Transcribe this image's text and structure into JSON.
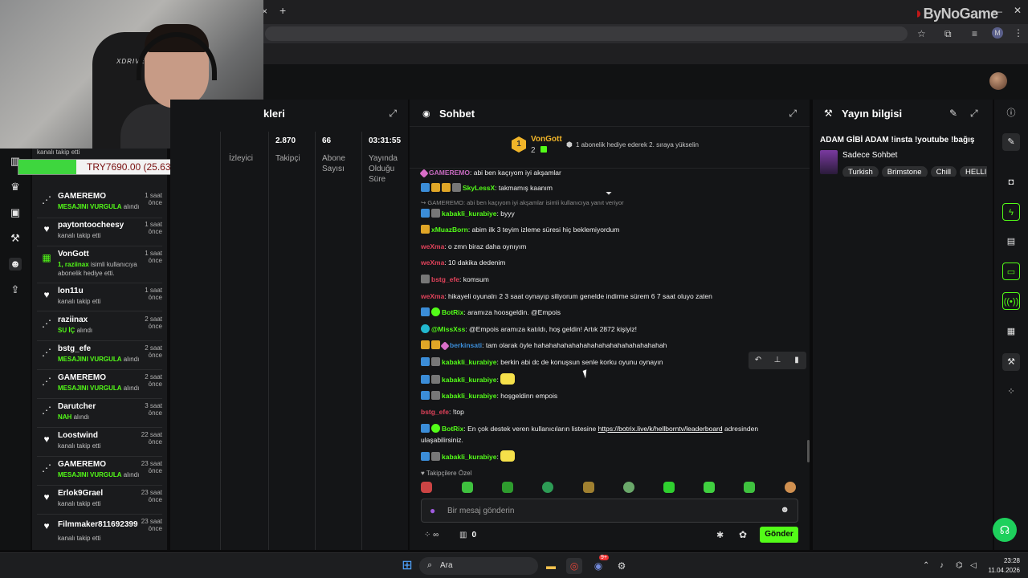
{
  "browser": {
    "close_tab": "×",
    "new_tab": "+",
    "watermark": "ByNoGame",
    "profile_initial": "M"
  },
  "webcam": {
    "chair_brand": "XDRIVE"
  },
  "donation": {
    "text": "TRY7690.00 (25.63%)",
    "progress_percent": 25.63,
    "fill_color": "#3ed63e"
  },
  "mini_sidebar": {
    "icons": [
      "chart-icon",
      "trophy-icon",
      "video-icon",
      "wrench-icon",
      "users-icon",
      "upload-icon"
    ]
  },
  "feed": {
    "top_line": "kanalı takip etti",
    "items": [
      {
        "icon": "share-icon",
        "user": "GAMEREMO",
        "time": "1 saat önce",
        "highlight": "MESAJINI VURGULA",
        "desc": "alındı"
      },
      {
        "icon": "heart-icon",
        "user": "paytontoocheesy",
        "time": "1 saat önce",
        "highlight": "",
        "desc": "kanalı takip etti"
      },
      {
        "icon": "gift-icon",
        "user": "VonGott",
        "time": "1 saat önce",
        "highlight": "1, raziinax",
        "desc": "isimli kullanıcıya",
        "desc2": "abonelik hediye etti."
      },
      {
        "icon": "heart-icon",
        "user": "lon11u",
        "time": "1 saat önce",
        "highlight": "",
        "desc": "kanalı takip etti"
      },
      {
        "icon": "share-icon",
        "user": "raziinax",
        "time": "2 saat önce",
        "highlight": "SU İÇ",
        "desc": "alındı"
      },
      {
        "icon": "share-icon",
        "user": "bstg_efe",
        "time": "2 saat önce",
        "highlight": "MESAJINI VURGULA",
        "desc": "alındı"
      },
      {
        "icon": "share-icon",
        "user": "GAMEREMO",
        "time": "2 saat önce",
        "highlight": "MESAJINI VURGULA",
        "desc": "alındı"
      },
      {
        "icon": "share-icon",
        "user": "Darutcher",
        "time": "3 saat önce",
        "highlight": "NAH",
        "desc": "alındı"
      },
      {
        "icon": "heart-icon",
        "user": "Loostwind",
        "time": "22 saat önce",
        "highlight": "",
        "desc": "kanalı takip etti"
      },
      {
        "icon": "share-icon",
        "user": "GAMEREMO",
        "time": "23 saat önce",
        "highlight": "MESAJINI VURGULA",
        "desc": "alındı"
      },
      {
        "icon": "heart-icon",
        "user": "Erlok9Grael",
        "time": "23 saat önce",
        "highlight": "",
        "desc": "kanalı takip etti"
      },
      {
        "icon": "heart-icon",
        "user": "Filmmaker811692399",
        "time": "23 saat önce",
        "highlight": "",
        "desc": "kanalı takip etti"
      }
    ]
  },
  "stats": {
    "title": "kleri",
    "hidden_label": "İzleyici",
    "columns": [
      {
        "value": "2.870",
        "label": "Takipçi"
      },
      {
        "value": "66",
        "label": "Abone Sayısı"
      },
      {
        "value": "03:31:55",
        "label": "Yayında Olduğu Süre"
      }
    ]
  },
  "chat": {
    "title": "Sohbet",
    "pinned": {
      "badge_number": "1",
      "user": "VonGott",
      "count": "2",
      "text": "1 abonelik hediye ederek 2. sıraya yükselin"
    },
    "reply_hint": "GAMEREMO: abi ben kaçıyom iyi akşamlar isimli kullanıcıya yanıt veriyor",
    "messages": [
      {
        "badges": [
          "pink"
        ],
        "user": "GAMEREMO",
        "color": "#c86ac0",
        "text": ": abi ben kaçıyom iyi akşamlar"
      },
      {
        "badges": [
          "blue",
          "gold",
          "gold",
          "gray"
        ],
        "user": "SkyLessX",
        "color": "#53fc18",
        "text": ": takmamış kaanım"
      },
      {
        "badges": [
          "blue",
          "gray"
        ],
        "user": "kabakli_kurabiye",
        "color": "#53fc18",
        "text": ": byyy"
      },
      {
        "badges": [
          "gold"
        ],
        "user": "xMuazBorn",
        "color": "#53fc18",
        "text": ": abim ilk 3 teyim izleme süresi hiç beklemiyordum"
      },
      {
        "badges": [],
        "user": "weXma",
        "color": "#e0425a",
        "text": ": o zmn biraz daha oynıyım"
      },
      {
        "badges": [],
        "user": "weXma",
        "color": "#e0425a",
        "text": ": 10 dakika dedenim"
      },
      {
        "badges": [
          "gray"
        ],
        "user": "bstg_efe",
        "color": "#e0425a",
        "text": ": komsum"
      },
      {
        "badges": [],
        "user": "weXma",
        "color": "#e0425a",
        "text": ": hikayeli oyunalrı 2 3 saat oynayıp siliyorum genelde indirme sürem 6 7 saat oluyo zaten"
      },
      {
        "badges": [
          "blue",
          "green"
        ],
        "user": "BotRix",
        "color": "#53fc18",
        "text": ": aramıza hoosgeldin. @Empois"
      },
      {
        "badges": [
          "cyan"
        ],
        "user": "@MissXss",
        "color": "#53fc18",
        "text": ": @Empois aramıza katıldı, hoş geldin! Artık 2872 kişiyiz!"
      },
      {
        "badges": [
          "gold",
          "gold",
          "pink"
        ],
        "user": "berkinsati",
        "color": "#3b8dd8",
        "text": ": tam olarak öyle hahahahahahahahahahahahahahahahahah"
      },
      {
        "badges": [
          "blue",
          "gray"
        ],
        "user": "kabakli_kurabiye",
        "color": "#53fc18",
        "text": ": berkin abi dc de konuşsun senle korku oyunu oynayın"
      },
      {
        "badges": [
          "blue",
          "gray"
        ],
        "user": "kabakli_kurabiye",
        "color": "#53fc18",
        "text": ": ",
        "emote": true
      },
      {
        "badges": [
          "blue",
          "gray"
        ],
        "user": "kabakli_kurabiye",
        "color": "#53fc18",
        "text": ": hoşgeldinn empois"
      },
      {
        "badges": [],
        "user": "bstg_efe",
        "color": "#e0425a",
        "text": ": !top"
      },
      {
        "badges": [
          "blue",
          "green"
        ],
        "user": "BotRix",
        "color": "#53fc18",
        "text": ": En çok destek veren kullanıcıların listesine ",
        "link": "https://botrix.live/k/hellborntv/leaderboard",
        "after": " adresinden",
        "line2": "ulaşabilirsiniz."
      },
      {
        "badges": [
          "blue",
          "gray"
        ],
        "user": "kabakli_kurabiye",
        "color": "#53fc18",
        "text": ": ",
        "emote": true
      }
    ],
    "emote_section_label": "Takipçilere Özel",
    "input_placeholder": "Bir mesaj gönderin",
    "footer_left": "∞",
    "footer_count": "0",
    "send_label": "Gönder"
  },
  "streaminfo": {
    "title": "Yayın bilgisi",
    "stream_title": "ADAM GİBİ ADAM !insta !youtube !bağış",
    "category": "Sadece Sohbet",
    "tags": [
      "Turkish",
      "Brimstone",
      "Chill",
      "HELLI"
    ]
  },
  "taskbar": {
    "search_text": "Ara",
    "time": "23:28",
    "date": "11.04.2026",
    "notification_badge": "9+"
  },
  "colors": {
    "accent": "#53fc18",
    "panel_bg": "#141517",
    "page_bg": "#0b0b0c"
  }
}
